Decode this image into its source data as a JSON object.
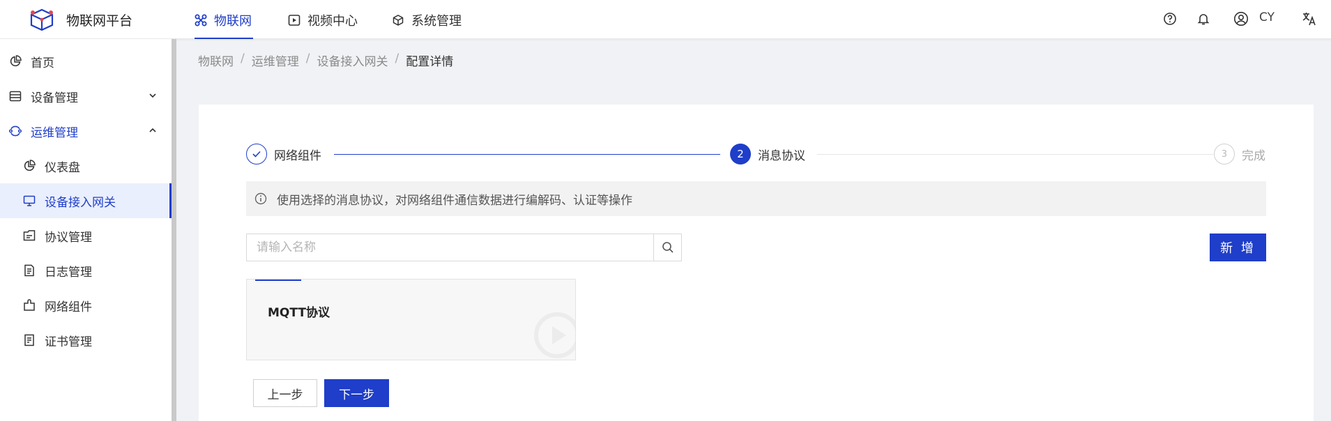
{
  "header": {
    "app_title": "物联网平台",
    "nav": [
      {
        "label": "物联网",
        "icon": "grid-icon",
        "active": true
      },
      {
        "label": "视频中心",
        "icon": "play-icon",
        "active": false
      },
      {
        "label": "系统管理",
        "icon": "cube-icon",
        "active": false
      }
    ],
    "user_name": "CY",
    "icons": [
      "help-icon",
      "bell-icon",
      "user-icon",
      "translate-icon"
    ]
  },
  "sidebar": {
    "items": [
      {
        "label": "首页",
        "icon": "pie-chart-icon",
        "level": 1
      },
      {
        "label": "设备管理",
        "icon": "server-icon",
        "level": 1,
        "arrow": "down"
      },
      {
        "label": "运维管理",
        "icon": "ops-icon",
        "level": 1,
        "arrow": "up",
        "open": true
      },
      {
        "label": "仪表盘",
        "icon": "pie-chart-icon",
        "level": 2
      },
      {
        "label": "设备接入网关",
        "icon": "monitor-icon",
        "level": 2,
        "selected": true
      },
      {
        "label": "协议管理",
        "icon": "folder-icon",
        "level": 2
      },
      {
        "label": "日志管理",
        "icon": "document-icon",
        "level": 2
      },
      {
        "label": "网络组件",
        "icon": "component-icon",
        "level": 2
      },
      {
        "label": "证书管理",
        "icon": "certificate-icon",
        "level": 2
      }
    ]
  },
  "breadcrumb": [
    "物联网",
    "运维管理",
    "设备接入网关",
    "配置详情"
  ],
  "steps": [
    {
      "label": "网络组件",
      "status": "done"
    },
    {
      "label": "消息协议",
      "status": "current",
      "number": "2"
    },
    {
      "label": "完成",
      "status": "pending",
      "number": "3"
    }
  ],
  "alert_text": "使用选择的消息协议，对网络组件通信数据进行编解码、认证等操作",
  "search": {
    "placeholder": "请输入名称",
    "value": ""
  },
  "add_label": "新 增",
  "protocols": [
    {
      "name": "MQTT协议"
    }
  ],
  "buttons": {
    "prev": "上一步",
    "next": "下一步"
  },
  "colors": {
    "primary": "#1f3ec9",
    "selected_bg": "#eaeffd"
  }
}
